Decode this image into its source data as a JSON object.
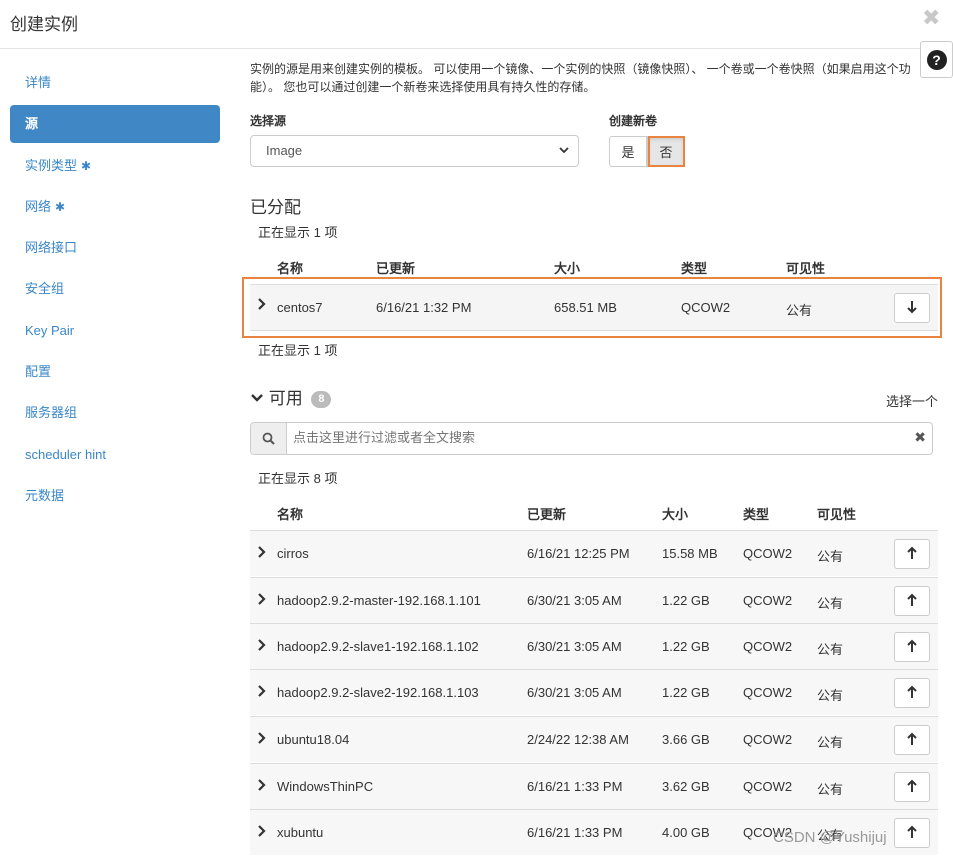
{
  "modal": {
    "title": "创建实例",
    "close": "✖",
    "help": "?"
  },
  "sidebar": {
    "items": [
      {
        "label": "详情"
      },
      {
        "label": "源"
      },
      {
        "label": "实例类型",
        "required": "✱"
      },
      {
        "label": "网络",
        "required": "✱"
      },
      {
        "label": "网络接口"
      },
      {
        "label": "安全组"
      },
      {
        "label": "Key Pair"
      },
      {
        "label": "配置"
      },
      {
        "label": "服务器组"
      },
      {
        "label": "scheduler hint"
      },
      {
        "label": "元数据"
      }
    ],
    "active_index": 1
  },
  "source": {
    "intro": "实例的源是用来创建实例的模板。 可以使用一个镜像、一个实例的快照（镜像快照）、 一个卷或一个卷快照（如果启用这个功能）。 您也可以通过创建一个新卷来选择使用具有持久性的存储。",
    "select_label": "选择源",
    "select_value": "Image",
    "new_volume_label": "创建新卷",
    "yes": "是",
    "no": "否",
    "new_volume_selected": "否"
  },
  "allocated": {
    "title": "已分配",
    "showing_top": "正在显示 1 项",
    "showing_bottom": "正在显示 1 项",
    "headers": {
      "name": "名称",
      "updated": "已更新",
      "size": "大小",
      "type": "类型",
      "visibility": "可见性"
    },
    "rows": [
      {
        "name": "centos7",
        "updated": "6/16/21 1:32 PM",
        "size": "658.51 MB",
        "type": "QCOW2",
        "visibility": "公有"
      }
    ]
  },
  "available": {
    "title": "可用",
    "count": "8",
    "select_one": "选择一个",
    "search_placeholder": "点击这里进行过滤或者全文搜索",
    "showing": "正在显示 8 项",
    "headers": {
      "name": "名称",
      "updated": "已更新",
      "size": "大小",
      "type": "类型",
      "visibility": "可见性"
    },
    "rows": [
      {
        "name": "cirros",
        "updated": "6/16/21 12:25 PM",
        "size": "15.58 MB",
        "type": "QCOW2",
        "visibility": "公有"
      },
      {
        "name": "hadoop2.9.2-master-192.168.1.101",
        "updated": "6/30/21 3:05 AM",
        "size": "1.22 GB",
        "type": "QCOW2",
        "visibility": "公有"
      },
      {
        "name": "hadoop2.9.2-slave1-192.168.1.102",
        "updated": "6/30/21 3:05 AM",
        "size": "1.22 GB",
        "type": "QCOW2",
        "visibility": "公有"
      },
      {
        "name": "hadoop2.9.2-slave2-192.168.1.103",
        "updated": "6/30/21 3:05 AM",
        "size": "1.22 GB",
        "type": "QCOW2",
        "visibility": "公有"
      },
      {
        "name": "ubuntu18.04",
        "updated": "2/24/22 12:38 AM",
        "size": "3.66 GB",
        "type": "QCOW2",
        "visibility": "公有"
      },
      {
        "name": "WindowsThinPC",
        "updated": "6/16/21 1:33 PM",
        "size": "3.62 GB",
        "type": "QCOW2",
        "visibility": "公有"
      },
      {
        "name": "xubuntu",
        "updated": "6/16/21 1:33 PM",
        "size": "4.00 GB",
        "type": "QCOW2",
        "visibility": "公有"
      }
    ]
  },
  "watermark": "CSDN @Yushijuj",
  "colors": {
    "accent": "#3f88c5",
    "highlight": "#e8843f"
  }
}
